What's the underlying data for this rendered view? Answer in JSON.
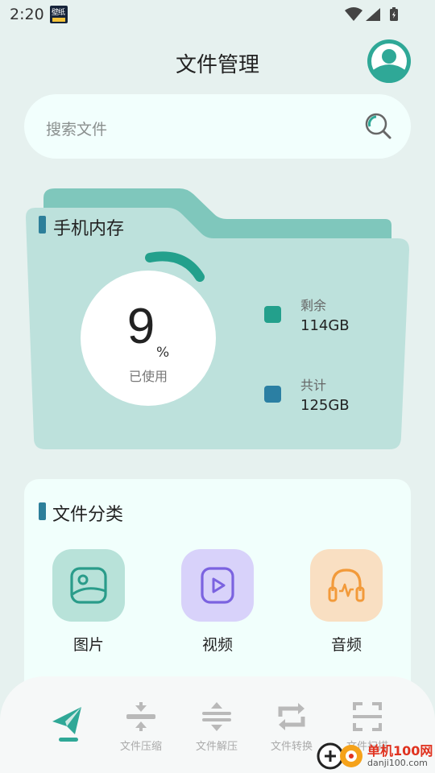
{
  "status_bar": {
    "time": "2:20",
    "app_icon_text": "壁纸"
  },
  "header": {
    "title": "文件管理"
  },
  "search": {
    "placeholder": "搜索文件"
  },
  "storage": {
    "label": "手机内存",
    "used_percent": "9",
    "percent_sign": "%",
    "used_label": "已使用",
    "remaining_label": "剩余",
    "remaining_value": "114GB",
    "total_label": "共计",
    "total_value": "125GB",
    "colors": {
      "remaining": "#23a08c",
      "total": "#2b7fa3",
      "folder": "#bde1dc",
      "folder_tab": "#7fc7bc"
    }
  },
  "categories": {
    "label": "文件分类",
    "items": [
      {
        "name": "图片",
        "icon": "image-icon",
        "color": "#b8e2d9"
      },
      {
        "name": "视频",
        "icon": "video-icon",
        "color": "#d8d2fa"
      },
      {
        "name": "音频",
        "icon": "audio-icon",
        "color": "#f9dfc2"
      }
    ]
  },
  "bottom_nav": {
    "items": [
      {
        "label": "",
        "icon": "send-icon",
        "active": true
      },
      {
        "label": "文件压缩",
        "icon": "compress-icon"
      },
      {
        "label": "文件解压",
        "icon": "decompress-icon"
      },
      {
        "label": "文件转换",
        "icon": "convert-icon"
      },
      {
        "label": "文件扫描",
        "icon": "scan-icon"
      }
    ]
  },
  "watermark": {
    "line1": "单机100网",
    "line2": "danji100.com"
  }
}
